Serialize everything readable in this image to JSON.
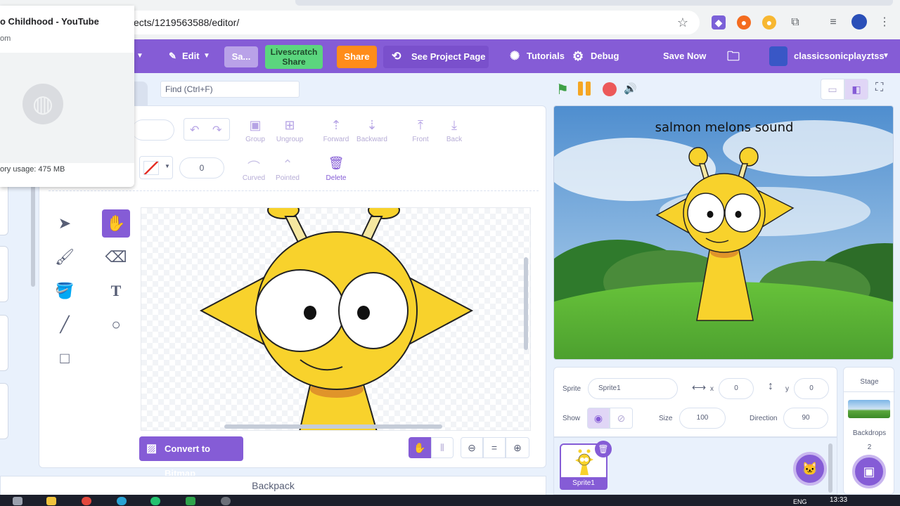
{
  "browser": {
    "url": "ects/1219563588/editor/",
    "popup": {
      "title": "o Childhood - YouTube",
      "subtitle": "om",
      "memory": "ory usage: 475 MB"
    }
  },
  "menubar": {
    "edit_label": "Edit",
    "sa_label": "Sa...",
    "livescratch_label": "Livescratch Share",
    "share_label": "Share",
    "see_project_label": "See Project Page",
    "tutorials_label": "Tutorials",
    "debug_label": "Debug",
    "save_now_label": "Save Now",
    "username": "classicsonicplayztss"
  },
  "paint_editor": {
    "find_placeholder": "Find (Ctrl+F)",
    "tools_top": [
      "Group",
      "Ungroup",
      "Forward",
      "Backward",
      "Front",
      "Back"
    ],
    "tools_bottom": [
      "Curved",
      "Pointed",
      "Delete"
    ],
    "outline_width": "0",
    "convert_label": "Convert to Bitmap",
    "zoom_equal": "="
  },
  "backpack_label": "Backpack",
  "stage": {
    "caption": "salmon melons sound"
  },
  "sprite_info": {
    "sprite_label": "Sprite",
    "sprite_name": "Sprite1",
    "x_label": "x",
    "x_value": "0",
    "y_label": "y",
    "y_value": "0",
    "show_label": "Show",
    "size_label": "Size",
    "size_value": "100",
    "direction_label": "Direction",
    "direction_value": "90"
  },
  "sprites": [
    {
      "name": "Sprite1"
    }
  ],
  "stage_panel": {
    "title": "Stage",
    "backdrops_label": "Backdrops",
    "backdrops_count": "2"
  },
  "taskbar": {
    "lang": "ENG",
    "time": "13:33"
  },
  "colors": {
    "accent": "#855cd6",
    "share": "#ff8c1a",
    "livescratch": "#5bd67e",
    "sprite_yellow": "#f8d22c"
  }
}
